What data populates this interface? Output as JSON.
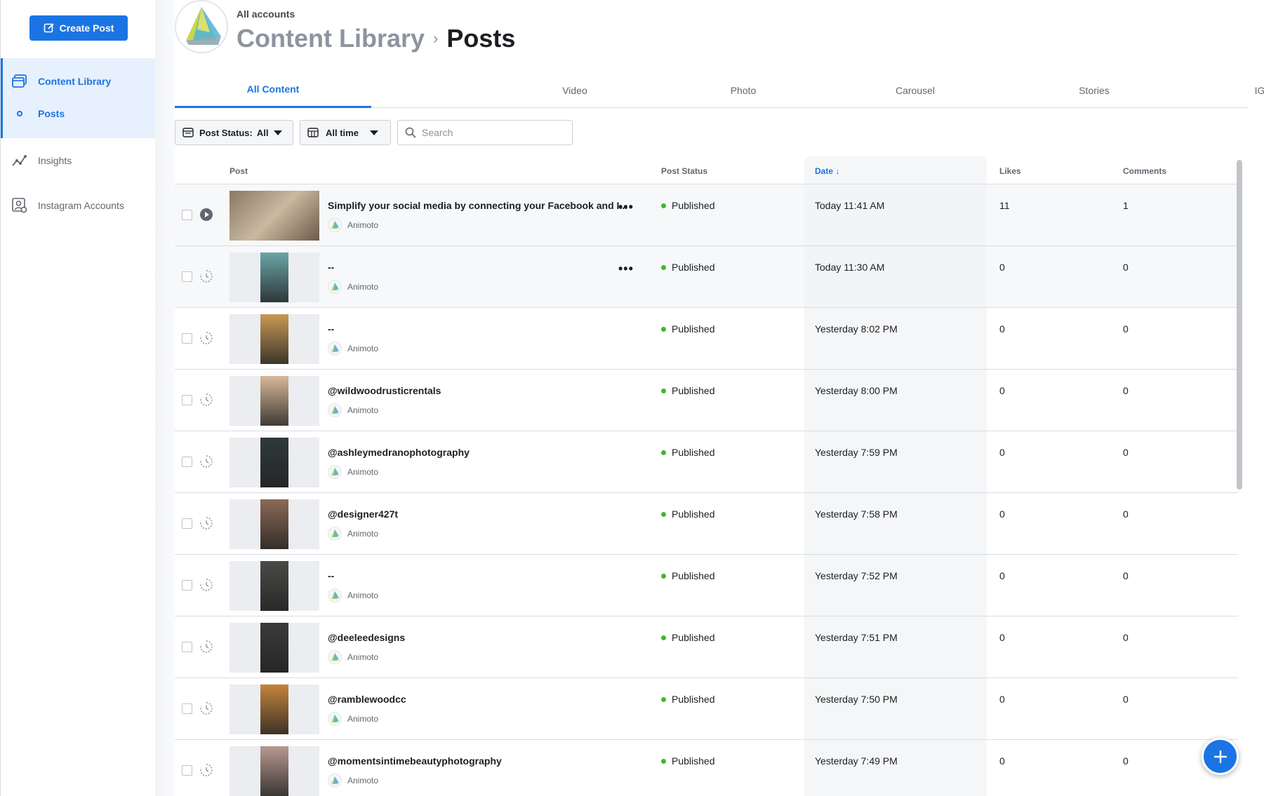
{
  "sidebar": {
    "create_label": "Create Post",
    "items": [
      {
        "label": "Content Library",
        "icon": "content-library-icon",
        "active": true
      },
      {
        "label": "Posts",
        "icon": "dot-ring-icon",
        "active": true
      },
      {
        "label": "Insights",
        "icon": "insights-icon",
        "active": false
      },
      {
        "label": "Instagram Accounts",
        "icon": "instagram-accounts-icon",
        "active": false
      }
    ]
  },
  "header": {
    "account_scope": "All accounts",
    "crumb_library": "Content Library",
    "crumb_separator": ">",
    "crumb_current": "Posts"
  },
  "tabs": [
    "All Content",
    "Video",
    "Photo",
    "Carousel",
    "Stories",
    "IGTV"
  ],
  "toolbar": {
    "post_status_label": "Post Status:",
    "post_status_value": "All",
    "time_label": "All time",
    "search_placeholder": "Search"
  },
  "table": {
    "columns": {
      "post": "Post",
      "status": "Post Status",
      "date": "Date ↓",
      "likes": "Likes",
      "comments": "Comments"
    },
    "rows": [
      {
        "title": "Simplify your social media by connecting your Facebook and I...",
        "account": "Animoto",
        "status": "Published",
        "date": "Today 11:41 AM",
        "likes": "11",
        "comments": "1",
        "type": "video",
        "thumb_color": "#8a7865",
        "more": "•••"
      },
      {
        "title": "--",
        "account": "Animoto",
        "status": "Published",
        "date": "Today 11:30 AM",
        "likes": "0",
        "comments": "0",
        "type": "story",
        "thumb_color": "#6aa5a8",
        "more": "•••"
      },
      {
        "title": "--",
        "account": "Animoto",
        "status": "Published",
        "date": "Yesterday 8:02 PM",
        "likes": "0",
        "comments": "0",
        "type": "story",
        "thumb_color": "#c89a55"
      },
      {
        "title": "@wildwoodrusticrentals",
        "account": "Animoto",
        "status": "Published",
        "date": "Yesterday 8:00 PM",
        "likes": "0",
        "comments": "0",
        "type": "story",
        "thumb_color": "#d8b89a"
      },
      {
        "title": "@ashleymedranophotography",
        "account": "Animoto",
        "status": "Published",
        "date": "Yesterday 7:59 PM",
        "likes": "0",
        "comments": "0",
        "type": "story",
        "thumb_color": "#2f3a3a"
      },
      {
        "title": "@designer427t",
        "account": "Animoto",
        "status": "Published",
        "date": "Yesterday 7:58 PM",
        "likes": "0",
        "comments": "0",
        "type": "story",
        "thumb_color": "#8a6a55"
      },
      {
        "title": "--",
        "account": "Animoto",
        "status": "Published",
        "date": "Yesterday 7:52 PM",
        "likes": "0",
        "comments": "0",
        "type": "story",
        "thumb_color": "#4a4a48"
      },
      {
        "title": "@deeleedesigns",
        "account": "Animoto",
        "status": "Published",
        "date": "Yesterday 7:51 PM",
        "likes": "0",
        "comments": "0",
        "type": "story",
        "thumb_color": "#3a3a3a"
      },
      {
        "title": "@ramblewoodcc",
        "account": "Animoto",
        "status": "Published",
        "date": "Yesterday 7:50 PM",
        "likes": "0",
        "comments": "0",
        "type": "story",
        "thumb_color": "#c4853a"
      },
      {
        "title": "@momentsintimebeautyphotography",
        "account": "Animoto",
        "status": "Published",
        "date": "Yesterday 7:49 PM",
        "likes": "0",
        "comments": "0",
        "type": "story",
        "thumb_color": "#b89a90"
      }
    ]
  },
  "colors": {
    "accent": "#1b74e4",
    "published": "#42b72a"
  }
}
